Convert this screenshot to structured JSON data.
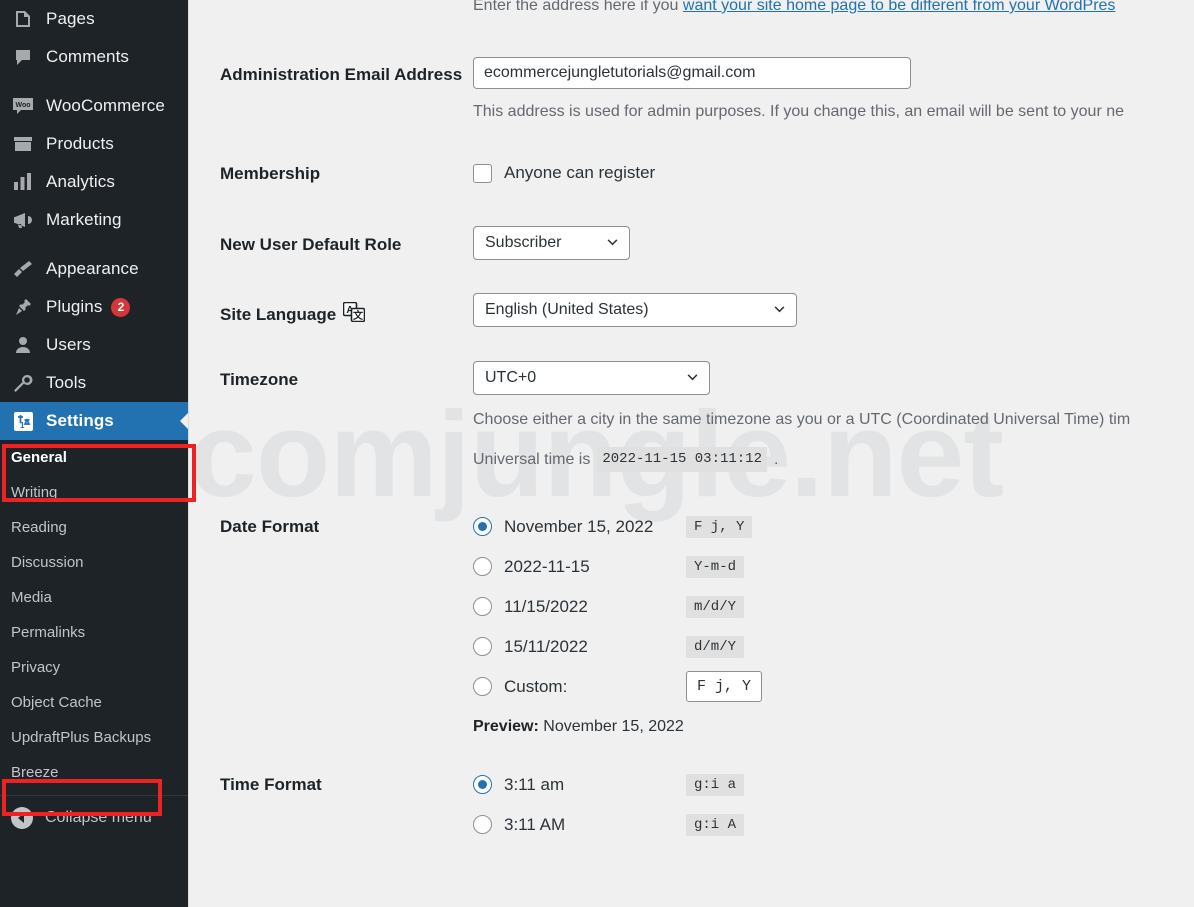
{
  "sidebar": {
    "items": [
      {
        "label": "Pages",
        "icon": "pages-icon",
        "badge": null
      },
      {
        "label": "Comments",
        "icon": "comments-icon",
        "badge": null
      },
      {
        "label": "WooCommerce",
        "icon": "woocommerce-icon",
        "badge": null
      },
      {
        "label": "Products",
        "icon": "products-icon",
        "badge": null
      },
      {
        "label": "Analytics",
        "icon": "analytics-icon",
        "badge": null
      },
      {
        "label": "Marketing",
        "icon": "marketing-icon",
        "badge": null
      },
      {
        "label": "Appearance",
        "icon": "appearance-icon",
        "badge": null
      },
      {
        "label": "Plugins",
        "icon": "plugins-icon",
        "badge": "2"
      },
      {
        "label": "Users",
        "icon": "users-icon",
        "badge": null
      },
      {
        "label": "Tools",
        "icon": "tools-icon",
        "badge": null
      },
      {
        "label": "Settings",
        "icon": "settings-icon",
        "badge": null
      }
    ],
    "settings_submenu": [
      "General",
      "Writing",
      "Reading",
      "Discussion",
      "Media",
      "Permalinks",
      "Privacy",
      "Object Cache",
      "UpdraftPlus Backups",
      "Breeze"
    ],
    "collapse_label": "Collapse menu",
    "selected_item": "Settings",
    "current_subitem": "General",
    "accent_color": "#2271b1",
    "background_color": "#1d2327",
    "badge_color": "#d63638"
  },
  "annotations": {
    "color": "#ee2222",
    "boxes": [
      "Settings",
      "UpdraftPlus Backups"
    ]
  },
  "watermark": {
    "text": "comjungle.net"
  },
  "main": {
    "site_address_note": {
      "prefix": "Enter the address here if you ",
      "link": "want your site home page to be different from your WordPres"
    },
    "admin_email": {
      "label": "Administration Email Address",
      "value": "ecommercejungletutorials@gmail.com",
      "description": "This address is used for admin purposes. If you change this, an email will be sent to your ne"
    },
    "membership": {
      "label": "Membership",
      "checkbox_label": "Anyone can register",
      "checked": false
    },
    "new_user_role": {
      "label": "New User Default Role",
      "value": "Subscriber"
    },
    "site_language": {
      "label": "Site Language",
      "value": "English (United States)",
      "icon": "translate-icon"
    },
    "timezone": {
      "label": "Timezone",
      "value": "UTC+0",
      "description": "Choose either a city in the same timezone as you or a UTC (Coordinated Universal Time) tim",
      "universal_time_prefix": "Universal time is",
      "universal_time_value": "2022-11-15 03:11:12",
      "universal_time_suffix": "."
    },
    "date_format": {
      "label": "Date Format",
      "options": [
        {
          "display": "November 15, 2022",
          "code": "F j, Y",
          "selected": true
        },
        {
          "display": "2022-11-15",
          "code": "Y-m-d",
          "selected": false
        },
        {
          "display": "11/15/2022",
          "code": "m/d/Y",
          "selected": false
        },
        {
          "display": "15/11/2022",
          "code": "d/m/Y",
          "selected": false
        }
      ],
      "custom_label": "Custom:",
      "custom_value": "F j, Y",
      "custom_selected": false,
      "preview_label": "Preview:",
      "preview_value": "November 15, 2022"
    },
    "time_format": {
      "label": "Time Format",
      "options": [
        {
          "display": "3:11 am",
          "code": "g:i a",
          "selected": true
        },
        {
          "display": "3:11 AM",
          "code": "g:i A",
          "selected": false
        }
      ]
    }
  }
}
